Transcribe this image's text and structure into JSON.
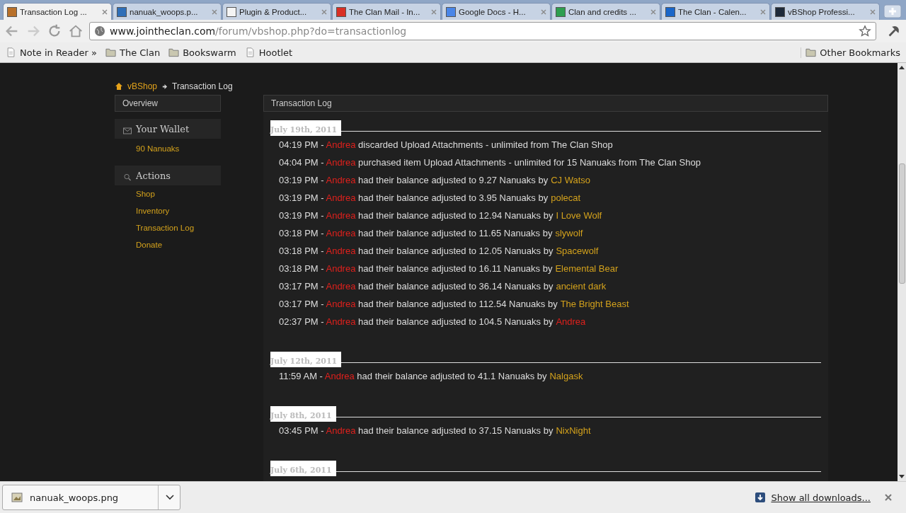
{
  "browser": {
    "tabs": [
      {
        "title": "Transaction Log ...",
        "selected": true
      },
      {
        "title": "nanuak_woops.p...",
        "selected": false
      },
      {
        "title": "Plugin & Product...",
        "selected": false
      },
      {
        "title": "The Clan Mail - In...",
        "selected": false
      },
      {
        "title": "Google Docs - H...",
        "selected": false
      },
      {
        "title": "Clan and credits ...",
        "selected": false
      },
      {
        "title": "The Clan - Calen...",
        "selected": false
      },
      {
        "title": "vBShop Professi...",
        "selected": false
      }
    ],
    "url_host": "www.jointheclan.com",
    "url_path": "/forum/vbshop.php?do=transactionlog",
    "bookmarks": [
      {
        "label": "Note in Reader »",
        "kind": "page"
      },
      {
        "label": "The Clan",
        "kind": "folder"
      },
      {
        "label": "Bookswarm",
        "kind": "folder"
      },
      {
        "label": "Hootlet",
        "kind": "page"
      }
    ],
    "other_bookmarks": "Other Bookmarks"
  },
  "breadcrumb": {
    "home": "vBShop",
    "current": "Transaction Log"
  },
  "sidebar": {
    "overview": "Overview",
    "wallet": {
      "title": "Your Wallet",
      "balance": "90 Nanuaks"
    },
    "actions": {
      "title": "Actions",
      "links": [
        "Shop",
        "Inventory",
        "Transaction Log",
        "Donate"
      ]
    }
  },
  "log": {
    "title": "Transaction Log",
    "groups": [
      {
        "date": "July 19th, 2011",
        "entries": [
          {
            "time": "04:19 PM -",
            "user": "Andrea",
            "text": "discarded Upload Attachments - unlimited from The Clan Shop"
          },
          {
            "time": "04:04 PM -",
            "user": "Andrea",
            "text": "purchased item Upload Attachments - unlimited for 15 Nanuaks from The Clan Shop"
          },
          {
            "time": "03:19 PM -",
            "user": "Andrea",
            "text": "had their balance adjusted to 9.27 Nanuaks by",
            "by": "CJ Watso",
            "by_self": false
          },
          {
            "time": "03:19 PM -",
            "user": "Andrea",
            "text": "had their balance adjusted to 3.95 Nanuaks by",
            "by": "polecat",
            "by_self": false
          },
          {
            "time": "03:19 PM -",
            "user": "Andrea",
            "text": "had their balance adjusted to 12.94 Nanuaks by",
            "by": "I Love Wolf",
            "by_self": false
          },
          {
            "time": "03:18 PM -",
            "user": "Andrea",
            "text": "had their balance adjusted to 11.65 Nanuaks by",
            "by": "slywolf",
            "by_self": false
          },
          {
            "time": "03:18 PM -",
            "user": "Andrea",
            "text": "had their balance adjusted to 12.05 Nanuaks by",
            "by": "Spacewolf",
            "by_self": false
          },
          {
            "time": "03:18 PM -",
            "user": "Andrea",
            "text": "had their balance adjusted to 16.11 Nanuaks by",
            "by": "Elemental Bear",
            "by_self": false
          },
          {
            "time": "03:17 PM -",
            "user": "Andrea",
            "text": "had their balance adjusted to 36.14 Nanuaks by",
            "by": "ancient dark",
            "by_self": false
          },
          {
            "time": "03:17 PM -",
            "user": "Andrea",
            "text": "had their balance adjusted to 112.54 Nanuaks by",
            "by": "The Bright Beast",
            "by_self": false
          },
          {
            "time": "02:37 PM -",
            "user": "Andrea",
            "text": "had their balance adjusted to 104.5 Nanuaks by",
            "by": "Andrea",
            "by_self": true
          }
        ]
      },
      {
        "date": "July 12th, 2011",
        "entries": [
          {
            "time": "11:59 AM -",
            "user": "Andrea",
            "text": "had their balance adjusted to 41.1 Nanuaks by",
            "by": "Nalgask",
            "by_self": false
          }
        ]
      },
      {
        "date": "July 8th, 2011",
        "entries": [
          {
            "time": "03:45 PM -",
            "user": "Andrea",
            "text": "had their balance adjusted to 37.15 Nanuaks by",
            "by": "NixNight",
            "by_self": false
          }
        ]
      },
      {
        "date": "July 6th, 2011"
      }
    ]
  },
  "downloads": {
    "file": "nanuak_woops.png",
    "show_all": "Show all downloads..."
  }
}
